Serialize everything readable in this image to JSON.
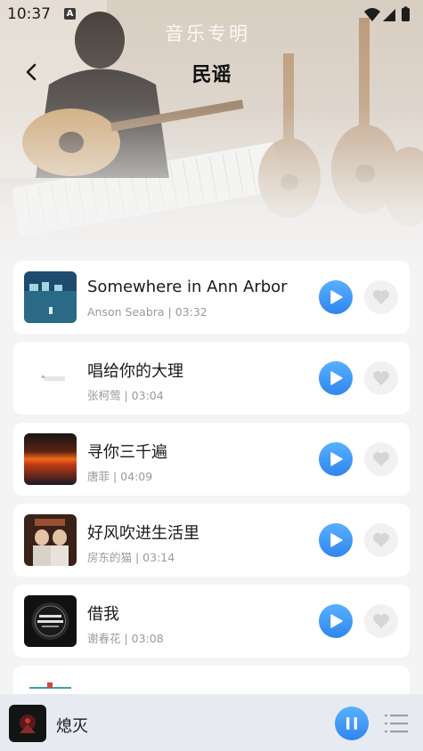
{
  "status_bar": {
    "time": "10:37",
    "notif_letter": "A"
  },
  "header": {
    "title": "民谣",
    "hero_watermark": "音乐专明"
  },
  "songs": [
    {
      "title": "Somewhere in Ann Arbor",
      "meta": "Anson Seabra | 03:32",
      "cover": "night-harbor"
    },
    {
      "title": "唱给你的大理",
      "meta": "张柯莺 | 03:04",
      "cover": "white-cover"
    },
    {
      "title": "寻你三千遍",
      "meta": "唐菲 | 04:09",
      "cover": "sunset"
    },
    {
      "title": "好风吹进生活里",
      "meta": "房东的猫 | 03:14",
      "cover": "duo-portrait"
    },
    {
      "title": "借我",
      "meta": "谢春花 | 03:08",
      "cover": "dark-badge"
    }
  ],
  "mini_player": {
    "title": "熄灭",
    "state": "playing"
  },
  "colors": {
    "accent": "#3b91f3",
    "card": "#ffffff",
    "bg": "#f4f4f4",
    "meta": "#9a9a9a"
  },
  "icons": [
    "back-arrow-icon",
    "play-icon",
    "heart-icon",
    "pause-icon",
    "playlist-icon",
    "wifi-icon",
    "signal-icon",
    "battery-icon"
  ]
}
